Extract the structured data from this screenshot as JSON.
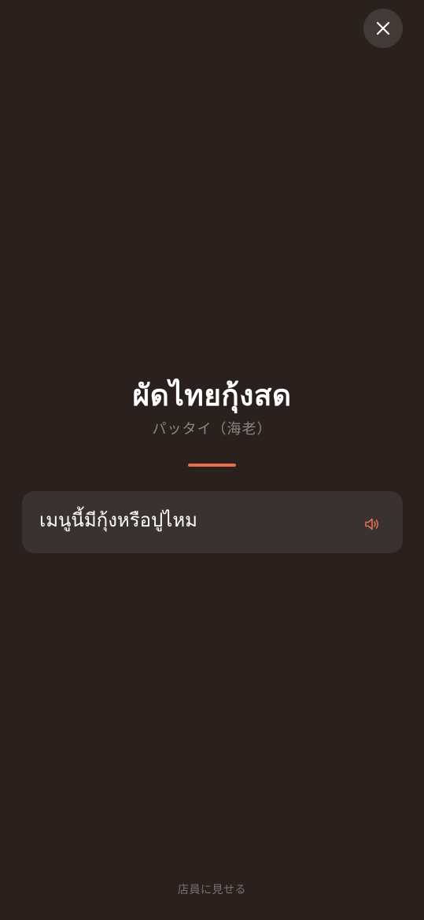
{
  "close": {
    "icon": "close-icon"
  },
  "menu_item": {
    "name_thai": "ผัดไทยกุ้งสด",
    "name_japanese": "パッタイ（海老）"
  },
  "phrase": {
    "text": "เมนูนี้มีกุ้งหรือปูไหม",
    "icon": "speaker-icon"
  },
  "footer": {
    "label": "店員に見せる"
  },
  "colors": {
    "background": "#2a211e",
    "accent": "#e66e4e",
    "card": "#3a3230",
    "close_button": "#413a37",
    "subtitle": "#8d8784"
  }
}
